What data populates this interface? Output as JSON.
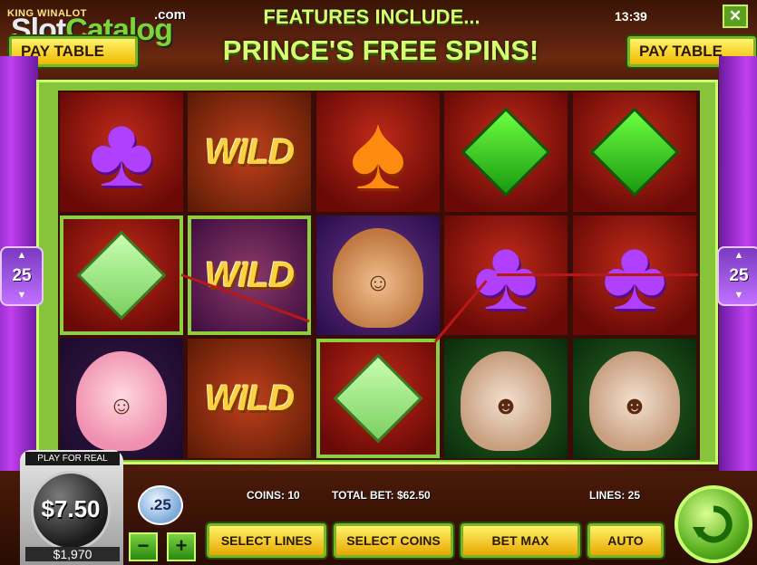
{
  "header": {
    "game_name": "KING WINALOT",
    "brand_slot": "Slot",
    "brand_catalog": "Catalog",
    "brand_domain": ".com",
    "feature_line1": "FEATURES INCLUDE...",
    "feature_line2": "PRINCE'S FREE SPINS!",
    "clock": "13:39",
    "close_label": "✕",
    "paytable_left": "PAY TABLE",
    "paytable_right": "PAY TABLE"
  },
  "lines_indicator": {
    "left": "25",
    "right": "25",
    "up": "▲",
    "down": "▼"
  },
  "reels": {
    "r1": [
      "club",
      "diamond",
      "girl"
    ],
    "r2": [
      "WILD",
      "WILD",
      "WILD"
    ],
    "r3": [
      "spade",
      "prince",
      "diamond"
    ],
    "r4": [
      "diamond",
      "club",
      "jester"
    ],
    "r5": [
      "diamond",
      "club",
      "jester"
    ]
  },
  "symbols": {
    "wild_text": "WILD",
    "club": "♣",
    "spade": "♠",
    "face_prince": "☺",
    "face_girl": "☺",
    "face_jester": "☻"
  },
  "info": {
    "coins": "COINS: 10",
    "total_bet": "TOTAL BET: $62.50",
    "lines": "LINES: 25"
  },
  "credit": {
    "play_for_real": "PLAY FOR REAL",
    "bet_value": "$7.50",
    "balance": "$1,970"
  },
  "coin_value": ".25",
  "buttons": {
    "minus": "−",
    "plus": "+",
    "select_lines": "SELECT LINES",
    "select_coins": "SELECT COINS",
    "bet_max": "BET MAX",
    "auto": "AUTO"
  },
  "colors": {
    "frame": "#86c43a",
    "payline": "#b81818",
    "accent_text": "#d6ff70",
    "button": "#f0b800"
  }
}
